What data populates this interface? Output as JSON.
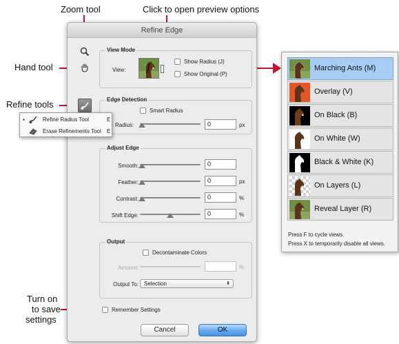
{
  "callouts": {
    "zoom_tool": "Zoom tool",
    "preview_options": "Click to open preview options",
    "hand_tool": "Hand tool",
    "refine_tools": "Refine tools",
    "save_settings_l1": "Turn on",
    "save_settings_l2": "to save",
    "save_settings_l3": "settings"
  },
  "dialog": {
    "title": "Refine Edge",
    "view_mode": {
      "title": "View Mode",
      "view_label": "View:",
      "show_radius": "Show Radius (J)",
      "show_original": "Show Original (P)"
    },
    "edge_detection": {
      "title": "Edge Detection",
      "smart_radius": "Smart Radius",
      "radius_label": "Radius:",
      "radius_value": "0",
      "unit": "px"
    },
    "adjust_edge": {
      "title": "Adjust Edge",
      "rows": [
        {
          "label": "Smooth:",
          "value": "0",
          "unit": ""
        },
        {
          "label": "Feather:",
          "value": "0",
          "unit": "px"
        },
        {
          "label": "Contrast:",
          "value": "0",
          "unit": "%"
        },
        {
          "label": "Shift Edge:",
          "value": "0",
          "unit": "%"
        }
      ]
    },
    "output": {
      "title": "Output",
      "decontaminate": "Decontaminate Colors",
      "amount_label": "Amount:",
      "amount_unit": "%",
      "output_to_label": "Output To:",
      "output_to_value": "Selection"
    },
    "remember": "Remember Settings",
    "cancel": "Cancel",
    "ok": "OK"
  },
  "refine_menu": {
    "items": [
      {
        "label": "Refine Radius Tool",
        "shortcut": "E",
        "active": true
      },
      {
        "label": "Erase Refinements Tool",
        "shortcut": "E",
        "active": false
      }
    ]
  },
  "view_menu": {
    "items": [
      {
        "label": "Marching Ants (M)",
        "selected": true
      },
      {
        "label": "Overlay (V)",
        "selected": false
      },
      {
        "label": "On Black (B)",
        "selected": false
      },
      {
        "label": "On White (W)",
        "selected": false
      },
      {
        "label": "Black & White (K)",
        "selected": false
      },
      {
        "label": "On Layers (L)",
        "selected": false
      },
      {
        "label": "Reveal Layer (R)",
        "selected": false
      }
    ],
    "tip1": "Press F to cycle views.",
    "tip2": "Press X to temporarily disable all views."
  },
  "colors": {
    "callout_red": "#c8102e",
    "selected_row": "#a7cdf5",
    "ok_button": "#62a7ee"
  }
}
